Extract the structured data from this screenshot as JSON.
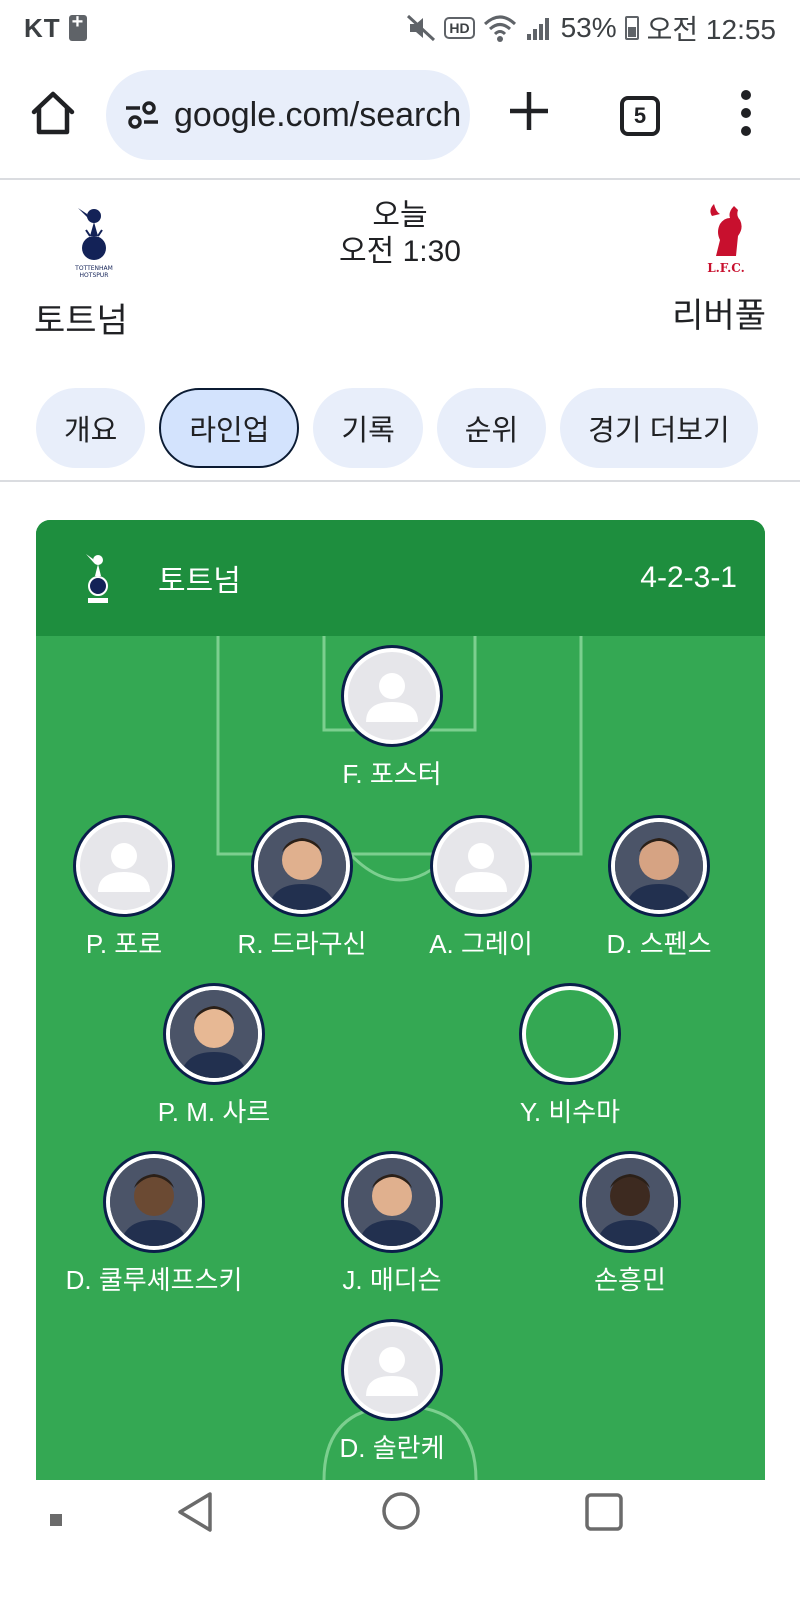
{
  "status_bar": {
    "carrier": "KT",
    "battery": "53%",
    "time": "오전 12:55"
  },
  "browser": {
    "url": "google.com/search",
    "tab_count": "5"
  },
  "match": {
    "home_team": "토트넘",
    "away_team": "리버풀",
    "date": "오늘",
    "time": "오전 1:30"
  },
  "tabs": [
    {
      "label": "개요",
      "active": false
    },
    {
      "label": "라인업",
      "active": true
    },
    {
      "label": "기록",
      "active": false
    },
    {
      "label": "순위",
      "active": false
    },
    {
      "label": "경기 더보기",
      "active": false
    }
  ],
  "lineup": {
    "team": "토트넘",
    "formation": "4-2-3-1",
    "players": [
      {
        "name": "F. 포스터",
        "avatar": "placeholder"
      },
      {
        "name": "P. 포로",
        "avatar": "placeholder"
      },
      {
        "name": "R. 드라구신",
        "avatar": "photo"
      },
      {
        "name": "A. 그레이",
        "avatar": "placeholder"
      },
      {
        "name": "D. 스펜스",
        "avatar": "photo"
      },
      {
        "name": "P. M. 사르",
        "avatar": "photo"
      },
      {
        "name": "Y. 비수마",
        "avatar": "empty"
      },
      {
        "name": "D. 쿨루셰프스키",
        "avatar": "photo"
      },
      {
        "name": "J. 매디슨",
        "avatar": "photo"
      },
      {
        "name": "손흥민",
        "avatar": "photo"
      },
      {
        "name": "D. 솔란케",
        "avatar": "placeholder"
      }
    ]
  },
  "colors": {
    "pitch": "#34a853",
    "pitch_header": "#1e8e3e",
    "chip": "#e8eefa",
    "chip_active": "#d3e3fd"
  }
}
